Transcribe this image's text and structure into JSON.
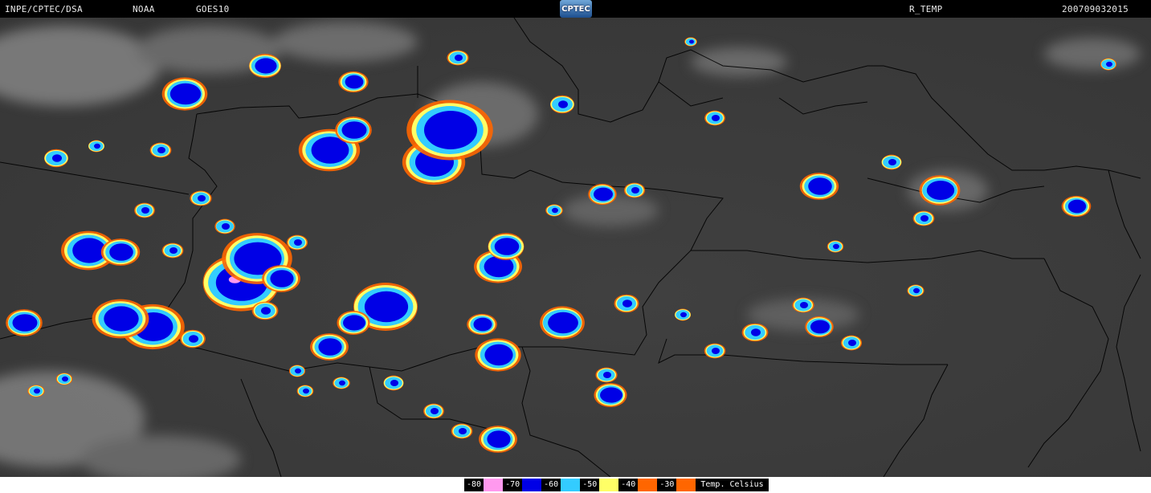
{
  "header": {
    "source": "INPE/CPTEC/DSA",
    "agency": "NOAA",
    "satellite": "GOES10",
    "logo_text": "CPTEC",
    "product": "R_TEMP",
    "timestamp": "200709032015"
  },
  "legend": {
    "title": "Temp. Celsius",
    "bins": [
      {
        "label": "-80",
        "color": "#ff99ee"
      },
      {
        "label": "-70",
        "color": "#0000e6"
      },
      {
        "label": "-60",
        "color": "#33ccff"
      },
      {
        "label": "-50",
        "color": "#ffff66"
      },
      {
        "label": "-40",
        "color": "#ff6600"
      },
      {
        "label": "-30",
        "color": "#ff6600"
      }
    ]
  },
  "colors": {
    "background": "#3d3d3d",
    "border_lines": "#000000",
    "cloud_gray": "#8a8a8a"
  }
}
